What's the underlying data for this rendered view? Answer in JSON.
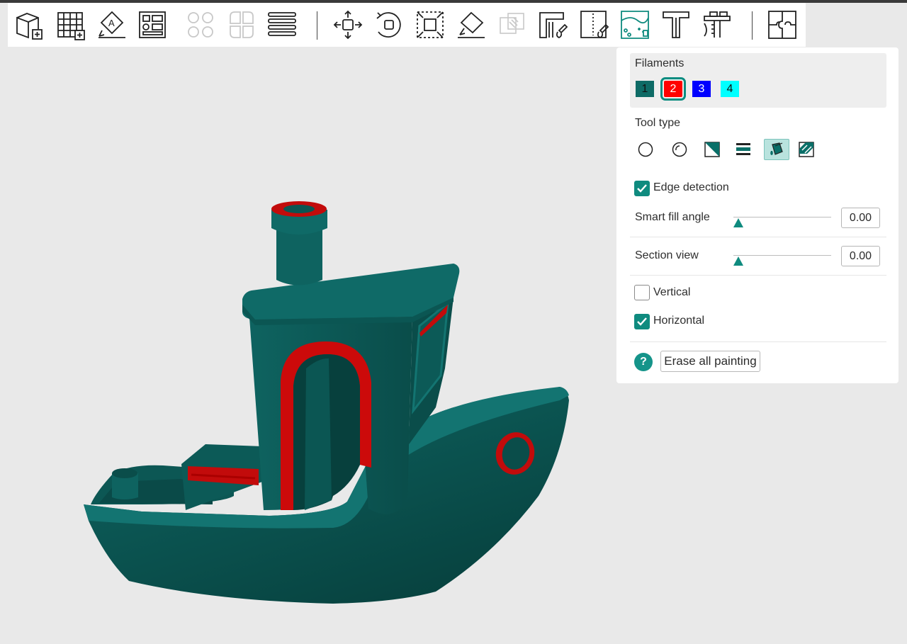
{
  "toolbar": {
    "items": [
      {
        "icon": "add-cube-icon"
      },
      {
        "icon": "add-plate-icon"
      },
      {
        "icon": "auto-orient-icon"
      },
      {
        "icon": "arrange-icon"
      },
      {
        "icon": "split-objects-icon"
      },
      {
        "icon": "split-parts-icon"
      },
      {
        "icon": "layers-icon"
      },
      {
        "icon": "move-icon"
      },
      {
        "icon": "rotate-icon"
      },
      {
        "icon": "scale-icon"
      },
      {
        "icon": "lay-on-face-icon"
      },
      {
        "icon": "cut-icon"
      },
      {
        "icon": "support-paint-icon"
      },
      {
        "icon": "seam-paint-icon"
      },
      {
        "icon": "color-paint-icon"
      },
      {
        "icon": "text-icon"
      },
      {
        "icon": "measure-icon"
      },
      {
        "icon": "assembly-icon"
      }
    ]
  },
  "panel": {
    "filaments_label": "Filaments",
    "filaments": [
      {
        "num": "1",
        "color": "#0e6b66"
      },
      {
        "num": "2",
        "color": "#ff0000"
      },
      {
        "num": "3",
        "color": "#0000ff"
      },
      {
        "num": "4",
        "color": "#00ffff"
      }
    ],
    "selected_filament": "2",
    "tool_type_label": "Tool type",
    "tools": [
      {
        "icon": "circle-brush-icon"
      },
      {
        "icon": "sphere-brush-icon"
      },
      {
        "icon": "triangle-fill-icon"
      },
      {
        "icon": "height-range-icon"
      },
      {
        "icon": "bucket-fill-icon"
      },
      {
        "icon": "gap-fill-icon"
      }
    ],
    "active_tool": "bucket-fill-icon",
    "edge_detection_label": "Edge detection",
    "edge_detection_checked": true,
    "smart_fill_label": "Smart fill angle",
    "smart_fill_value": "0.00",
    "section_view_label": "Section view",
    "section_view_value": "0.00",
    "vertical_label": "Vertical",
    "vertical_checked": false,
    "horizontal_label": "Horizontal",
    "horizontal_checked": true,
    "help_symbol": "?",
    "erase_label": "Erase all painting"
  },
  "colors": {
    "accent": "#0f8b7f",
    "model": "#0e5f5c",
    "paint": "#d10000",
    "background": "#e9e9e9"
  }
}
